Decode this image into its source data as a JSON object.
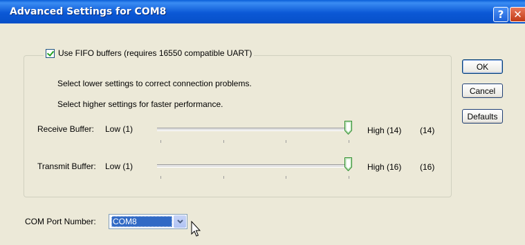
{
  "window": {
    "title": "Advanced Settings for COM8",
    "help_glyph": "?",
    "close_glyph": "✕"
  },
  "fifo": {
    "label": "Use FIFO buffers (requires 16550 compatible UART)",
    "checked": true
  },
  "hints": {
    "lower": "Select lower settings to correct connection problems.",
    "higher": "Select higher settings for faster performance."
  },
  "receive": {
    "label": "Receive Buffer:",
    "low_label": "Low (1)",
    "high_label": "High (14)",
    "value_label": "(14)",
    "min": 1,
    "max": 14,
    "value": 14
  },
  "transmit": {
    "label": "Transmit Buffer:",
    "low_label": "Low (1)",
    "high_label": "High (16)",
    "value_label": "(16)",
    "min": 1,
    "max": 16,
    "value": 16
  },
  "buttons": {
    "ok": "OK",
    "cancel": "Cancel",
    "defaults": "Defaults"
  },
  "com_port": {
    "label": "COM Port Number:",
    "selected": "COM8"
  },
  "colors": {
    "titlebar": "#0b58d6",
    "selection": "#316ac5",
    "face": "#ece9d8",
    "check": "#21a121"
  }
}
